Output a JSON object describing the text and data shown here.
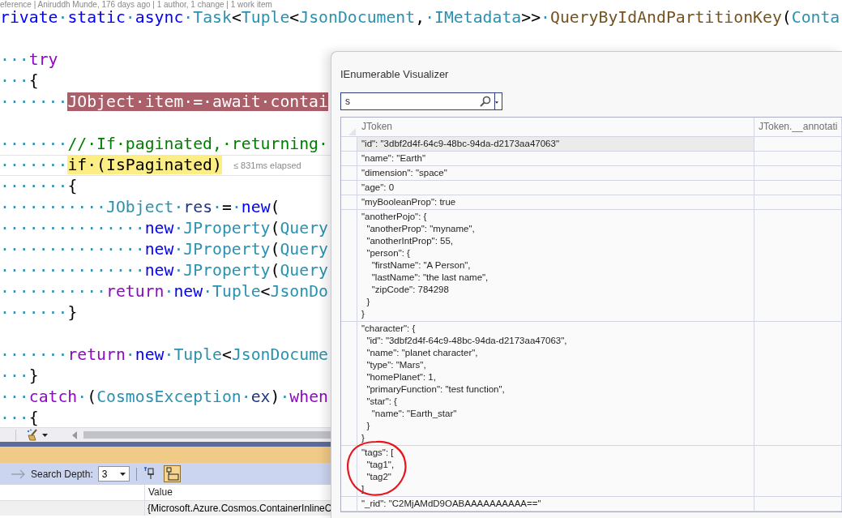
{
  "editor": {
    "codelens": "eference | Aniruddh Munde, 176 days ago | 1 author, 1 change | 1 work item",
    "lines": [
      {
        "current": false,
        "tokens": [
          {
            "text": "rivate",
            "kind": "kw"
          },
          {
            "text": "·",
            "kind": "ws"
          },
          {
            "text": "static",
            "kind": "kw"
          },
          {
            "text": "·",
            "kind": "ws"
          },
          {
            "text": "async",
            "kind": "kw"
          },
          {
            "text": "·",
            "kind": "ws"
          },
          {
            "text": "Task",
            "kind": "type"
          },
          {
            "text": "<",
            "kind": "plain"
          },
          {
            "text": "Tuple",
            "kind": "type"
          },
          {
            "text": "<",
            "kind": "plain"
          },
          {
            "text": "JsonDocument",
            "kind": "type"
          },
          {
            "text": ",",
            "kind": "plain"
          },
          {
            "text": "·",
            "kind": "ws"
          },
          {
            "text": "IMetadata",
            "kind": "type"
          },
          {
            "text": ">>",
            "kind": "plain"
          },
          {
            "text": "·",
            "kind": "ws"
          },
          {
            "text": "QueryByIdAndPartitionKey",
            "kind": "method"
          },
          {
            "text": "(",
            "kind": "plain"
          },
          {
            "text": "Conta",
            "kind": "type"
          }
        ]
      },
      {
        "current": false
      },
      {
        "current": false,
        "tokens": [
          {
            "text": "···",
            "kind": "ws"
          },
          {
            "text": "try",
            "kind": "ctl"
          }
        ]
      },
      {
        "current": false,
        "tokens": [
          {
            "text": "···",
            "kind": "ws"
          },
          {
            "text": "{",
            "kind": "plain"
          }
        ]
      },
      {
        "current": false,
        "tokens": [
          {
            "text": "·······",
            "kind": "ws"
          },
          {
            "text": "JObject·item·=·await·contai",
            "kind": "bp"
          }
        ]
      },
      {
        "current": false
      },
      {
        "current": false,
        "tokens": [
          {
            "text": "·······",
            "kind": "ws"
          },
          {
            "text": "//·If·paginated,·returning·",
            "kind": "comment"
          }
        ]
      },
      {
        "current": true,
        "tokens": [
          {
            "text": "·······",
            "kind": "ws"
          },
          {
            "text": "if·(IsPaginated)",
            "kind": "cur"
          },
          {
            "text": "≤ 831ms elapsed",
            "kind": "hint"
          }
        ]
      },
      {
        "current": false,
        "tokens": [
          {
            "text": "·······",
            "kind": "ws"
          },
          {
            "text": "{",
            "kind": "plain"
          }
        ]
      },
      {
        "current": false,
        "tokens": [
          {
            "text": "···········",
            "kind": "ws"
          },
          {
            "text": "JObject",
            "kind": "type"
          },
          {
            "text": "·",
            "kind": "ws"
          },
          {
            "text": "res",
            "kind": "var"
          },
          {
            "text": "·",
            "kind": "ws"
          },
          {
            "text": "=",
            "kind": "plain"
          },
          {
            "text": "·",
            "kind": "ws"
          },
          {
            "text": "new",
            "kind": "kw"
          },
          {
            "text": "(",
            "kind": "plain"
          }
        ]
      },
      {
        "current": false,
        "tokens": [
          {
            "text": "···············",
            "kind": "ws"
          },
          {
            "text": "new",
            "kind": "kw"
          },
          {
            "text": "·",
            "kind": "ws"
          },
          {
            "text": "JProperty",
            "kind": "type"
          },
          {
            "text": "(",
            "kind": "plain"
          },
          {
            "text": "Query",
            "kind": "type"
          }
        ]
      },
      {
        "current": false,
        "tokens": [
          {
            "text": "···············",
            "kind": "ws"
          },
          {
            "text": "new",
            "kind": "kw"
          },
          {
            "text": "·",
            "kind": "ws"
          },
          {
            "text": "JProperty",
            "kind": "type"
          },
          {
            "text": "(",
            "kind": "plain"
          },
          {
            "text": "Query",
            "kind": "type"
          }
        ]
      },
      {
        "current": false,
        "tokens": [
          {
            "text": "···············",
            "kind": "ws"
          },
          {
            "text": "new",
            "kind": "kw"
          },
          {
            "text": "·",
            "kind": "ws"
          },
          {
            "text": "JProperty",
            "kind": "type"
          },
          {
            "text": "(",
            "kind": "plain"
          },
          {
            "text": "Query",
            "kind": "type"
          }
        ]
      },
      {
        "current": false,
        "tokens": [
          {
            "text": "···········",
            "kind": "ws"
          },
          {
            "text": "return",
            "kind": "ctl"
          },
          {
            "text": "·",
            "kind": "ws"
          },
          {
            "text": "new",
            "kind": "kw"
          },
          {
            "text": "·",
            "kind": "ws"
          },
          {
            "text": "Tuple",
            "kind": "type"
          },
          {
            "text": "<",
            "kind": "plain"
          },
          {
            "text": "JsonDo",
            "kind": "type"
          }
        ]
      },
      {
        "current": false,
        "tokens": [
          {
            "text": "·······",
            "kind": "ws"
          },
          {
            "text": "}",
            "kind": "plain"
          }
        ]
      },
      {
        "current": false
      },
      {
        "current": false,
        "tokens": [
          {
            "text": "·······",
            "kind": "ws"
          },
          {
            "text": "return",
            "kind": "ctl"
          },
          {
            "text": "·",
            "kind": "ws"
          },
          {
            "text": "new",
            "kind": "kw"
          },
          {
            "text": "·",
            "kind": "ws"
          },
          {
            "text": "Tuple",
            "kind": "type"
          },
          {
            "text": "<",
            "kind": "plain"
          },
          {
            "text": "JsonDocume",
            "kind": "type"
          }
        ]
      },
      {
        "current": false,
        "tokens": [
          {
            "text": "···",
            "kind": "ws"
          },
          {
            "text": "}",
            "kind": "plain"
          }
        ]
      },
      {
        "current": false,
        "tokens": [
          {
            "text": "···",
            "kind": "ws"
          },
          {
            "text": "catch",
            "kind": "ctl"
          },
          {
            "text": "·",
            "kind": "ws"
          },
          {
            "text": "(",
            "kind": "plain"
          },
          {
            "text": "CosmosException",
            "kind": "type"
          },
          {
            "text": "·",
            "kind": "ws"
          },
          {
            "text": "ex",
            "kind": "var"
          },
          {
            "text": ")",
            "kind": "plain"
          },
          {
            "text": "·",
            "kind": "ws"
          },
          {
            "text": "when",
            "kind": "ctl"
          }
        ]
      },
      {
        "current": false,
        "tokens": [
          {
            "text": "···",
            "kind": "ws"
          },
          {
            "text": "{",
            "kind": "plain"
          }
        ]
      }
    ]
  },
  "debug_panel": {
    "search_depth_label": "Search Depth:",
    "search_depth": "3",
    "tool_buttons": [
      {
        "pressed": false
      },
      {
        "pressed": true
      }
    ],
    "columns": [
      "Value"
    ],
    "rows": [
      [
        "{Microsoft.Azure.Cosmos.ContainerInlineC"
      ]
    ]
  },
  "visualizer": {
    "title": "IEnumerable Visualizer",
    "search": {
      "value": "s"
    },
    "columns": [
      "JToken",
      "JToken.__annotati"
    ],
    "rows": [
      {
        "text": "\"id\": \"3dbf2d4f-64c9-48bc-94da-d2173aa47063\"",
        "selected": true,
        "circled": false
      },
      {
        "text": "\"name\": \"Earth\"",
        "selected": false,
        "circled": false
      },
      {
        "text": "\"dimension\": \"space\"",
        "selected": false,
        "circled": false
      },
      {
        "text": "\"age\": 0",
        "selected": false,
        "circled": false
      },
      {
        "text": "\"myBooleanProp\": true",
        "selected": false,
        "circled": false
      },
      {
        "text": "\"anotherPojo\": {\n  \"anotherProp\": \"myname\",\n  \"anotherIntProp\": 55,\n  \"person\": {\n    \"firstName\": \"A Person\",\n    \"lastName\": \"the last name\",\n    \"zipCode\": 784298\n  }\n}",
        "selected": false,
        "circled": false
      },
      {
        "text": "\"character\": {\n  \"id\": \"3dbf2d4f-64c9-48bc-94da-d2173aa47063\",\n  \"name\": \"planet character\",\n  \"type\": \"Mars\",\n  \"homePlanet\": 1,\n  \"primaryFunction\": \"test function\",\n  \"star\": {\n    \"name\": \"Earth_star\"\n  }\n}",
        "selected": false,
        "circled": false
      },
      {
        "text": "\"tags\": [\n  \"tag1\",\n  \"tag2\"\n]",
        "selected": false,
        "circled": true
      },
      {
        "text": "\"_rid\": \"C2MjAMdD9OABAAAAAAAAAA==\"",
        "selected": false,
        "circled": false
      }
    ]
  }
}
